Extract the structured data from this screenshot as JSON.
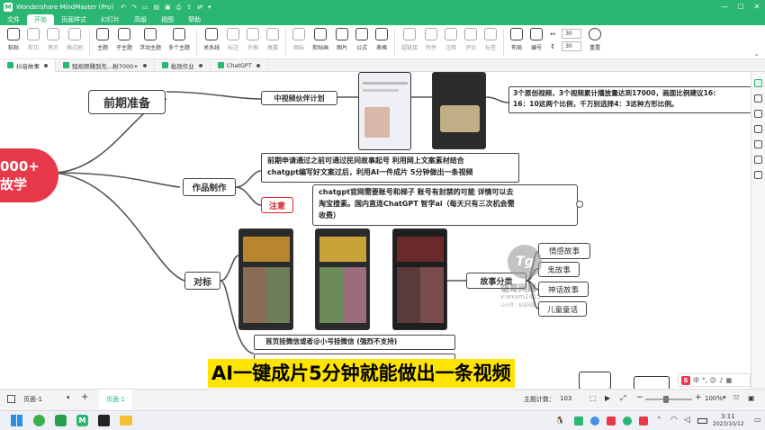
{
  "titlebar": {
    "app_title": "Wondershare MindMaster (Pro)",
    "window_controls": [
      "—",
      "☐",
      "✕"
    ]
  },
  "menubar": {
    "tabs": [
      "文件",
      "开始",
      "页面样式",
      "幻灯片",
      "高级",
      "视图",
      "帮助"
    ],
    "active_tab": "开始"
  },
  "ribbon": {
    "buttons": [
      {
        "label": "粘贴",
        "enabled": true
      },
      {
        "label": "剪切",
        "enabled": false
      },
      {
        "label": "拷贝",
        "enabled": false
      },
      {
        "label": "格式刷",
        "enabled": false
      },
      {
        "label": "主题",
        "enabled": true
      },
      {
        "label": "子主题",
        "enabled": true
      },
      {
        "label": "浮动主题",
        "enabled": true
      },
      {
        "label": "多个主题",
        "enabled": true
      },
      {
        "label": "关系线",
        "enabled": true
      },
      {
        "label": "标注",
        "enabled": false
      },
      {
        "label": "外框",
        "enabled": false
      },
      {
        "label": "概要",
        "enabled": false
      },
      {
        "label": "图标",
        "enabled": false
      },
      {
        "label": "剪贴画",
        "enabled": true
      },
      {
        "label": "图片",
        "enabled": true
      },
      {
        "label": "公式",
        "enabled": true
      },
      {
        "label": "表格",
        "enabled": true
      },
      {
        "label": "超链接",
        "enabled": false
      },
      {
        "label": "附件",
        "enabled": false
      },
      {
        "label": "注释",
        "enabled": false
      },
      {
        "label": "评论",
        "enabled": false
      },
      {
        "label": "标签",
        "enabled": false
      },
      {
        "label": "布局",
        "enabled": true
      },
      {
        "label": "编号",
        "enabled": true
      }
    ],
    "spacing_values": [
      "30",
      "30"
    ],
    "reset_label": "重置"
  },
  "doc_tabs": [
    {
      "label": "抖音故事",
      "active": true
    },
    {
      "label": "短视频赚到先...粉7000+",
      "active": false
    },
    {
      "label": "批改作业",
      "active": false
    },
    {
      "label": "ChatGPT",
      "active": false
    }
  ],
  "mindmap": {
    "root_text": "000+\n故学",
    "branch_prep": "前期准备",
    "node_partner": "中视频伙伴计划",
    "partner_note_lines": [
      "3个原创视频，3个视频累计播放量达到17000，画面比例建议16:",
      "16：10这两个比例，千万别选择4：3这种方形比例。"
    ],
    "branch_make": "作品制作",
    "make_note_lines": [
      "前期申请通过之前可通过民间故事起号 利用网上文案素材结合",
      "chatgpt编写好文案过后，利用AI一件成片 5分钟做出一条视频"
    ],
    "node_notice": "注意",
    "notice_note_lines": [
      "chatgpt官网需要账号和梯子 账号有封禁的可能 详情可以去",
      "淘宝搜素。国内直连ChatGPT 智学ai（每天只有三次机会需",
      "收费）"
    ],
    "branch_bench": "对标",
    "node_category": "故事分类",
    "categories": [
      "情感故事",
      "鬼故事",
      "神话故事",
      "儿童童话"
    ],
    "bottom_note": "首页挂微信或者@小号挂微信 (强烈不支持)"
  },
  "overlay": {
    "subtitle": "AI一键成片5分钟就能做出一条视频",
    "watermark_line1": "韬哥网赚",
    "watermark_line2": "v:wxxm2415",
    "watermark_line3": "公众号：韬哥网赚"
  },
  "statusbar": {
    "page_selector": "页面-1",
    "page_tab": "页面-1",
    "count_label": "主题计数：",
    "count_value": "103",
    "zoom": "100%"
  },
  "taskbar": {
    "time": "3:11",
    "date": "2023/10/12",
    "ime_label": "中"
  },
  "colors": {
    "brand_green": "#2bb673",
    "root_red": "#e8394a",
    "notice_red": "#d9232e",
    "subtitle_yellow": "#ffe400"
  }
}
